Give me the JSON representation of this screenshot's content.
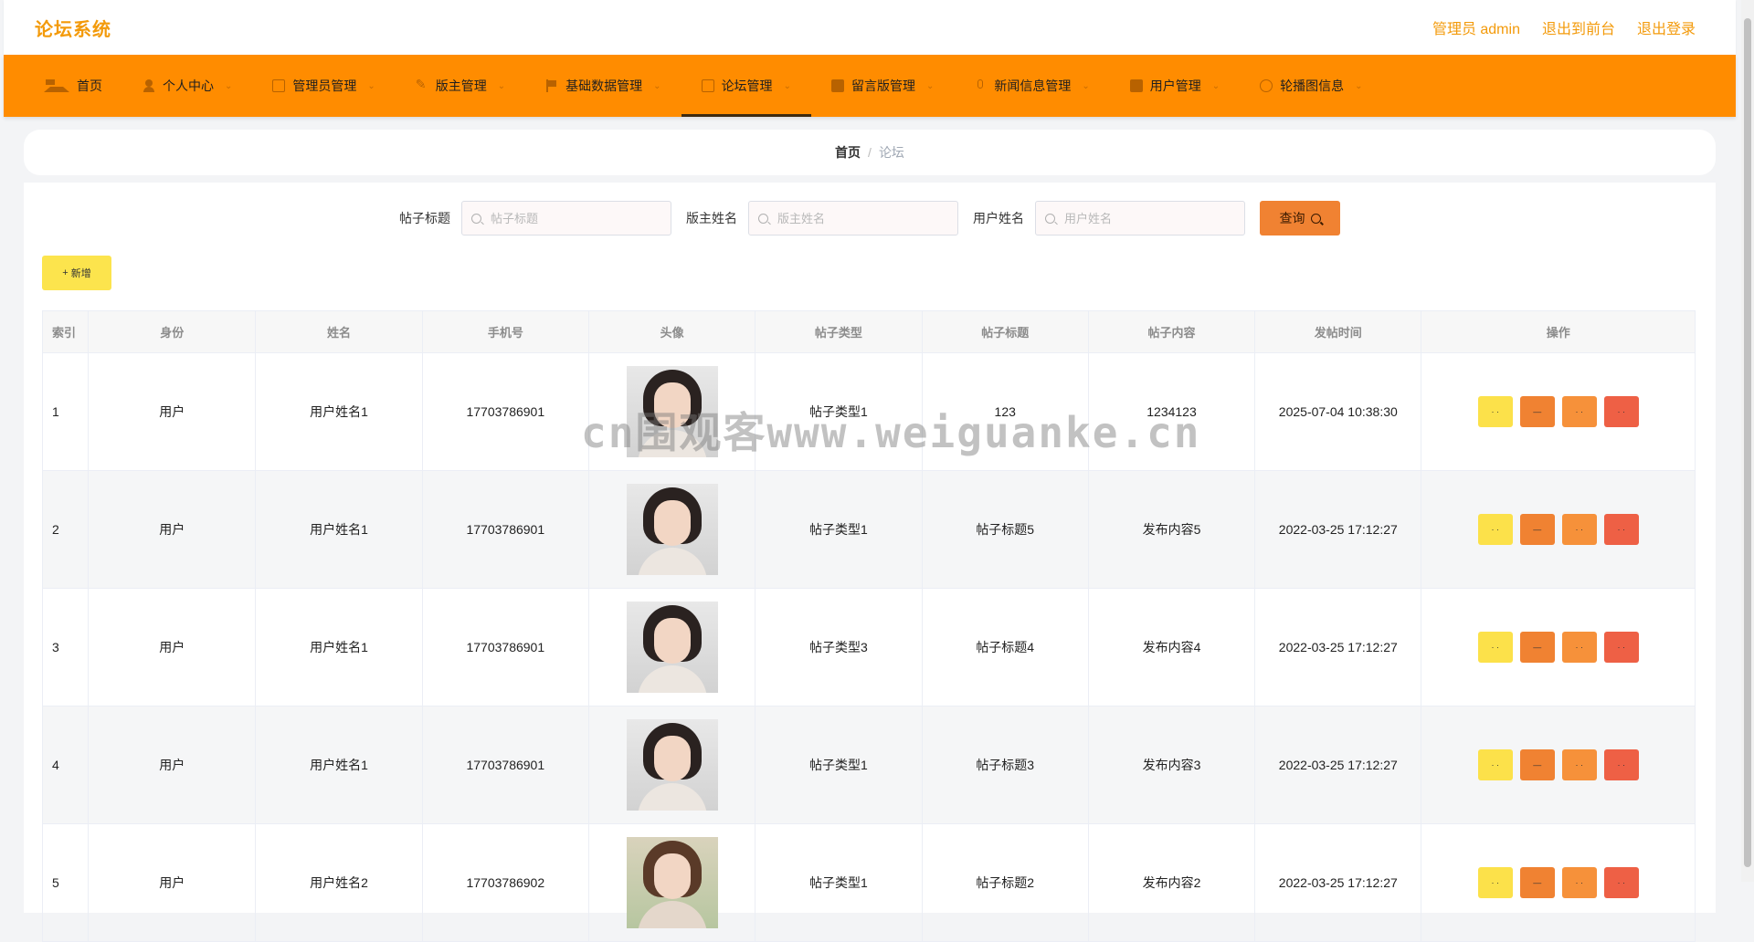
{
  "header": {
    "brand": "论坛系统",
    "links": [
      "管理员 admin",
      "退出到前台",
      "退出登录"
    ]
  },
  "nav": [
    {
      "label": "首页",
      "icon": "home-icon"
    },
    {
      "label": "个人中心",
      "icon": "user-icon"
    },
    {
      "label": "管理员管理",
      "icon": "admin-icon"
    },
    {
      "label": "版主管理",
      "icon": "edit-icon"
    },
    {
      "label": "基础数据管理",
      "icon": "flag-icon"
    },
    {
      "label": "论坛管理",
      "icon": "forum-icon",
      "active": true
    },
    {
      "label": "留言版管理",
      "icon": "message-icon"
    },
    {
      "label": "新闻信息管理",
      "icon": "mic-icon"
    },
    {
      "label": "用户管理",
      "icon": "users-icon"
    },
    {
      "label": "轮播图信息",
      "icon": "carousel-icon"
    }
  ],
  "breadcrumb": {
    "home": "首页",
    "sep": "/",
    "current": "论坛"
  },
  "search": {
    "fields": [
      {
        "label": "帖子标题",
        "placeholder": "帖子标题"
      },
      {
        "label": "版主姓名",
        "placeholder": "版主姓名"
      },
      {
        "label": "用户姓名",
        "placeholder": "用户姓名"
      }
    ],
    "query_label": "查询"
  },
  "add_button": {
    "icon": "+",
    "label": "新增"
  },
  "table": {
    "columns": [
      "索引",
      "身份",
      "姓名",
      "手机号",
      "头像",
      "帖子类型",
      "帖子标题",
      "帖子内容",
      "发帖时间",
      "操作"
    ],
    "rows": [
      {
        "idx": "1",
        "role": "用户",
        "name": "用户姓名1",
        "phone": "17703786901",
        "type": "帖子类型1",
        "title": "123",
        "content": "1234123",
        "time": "2025-07-04 10:38:30"
      },
      {
        "idx": "2",
        "role": "用户",
        "name": "用户姓名1",
        "phone": "17703786901",
        "type": "帖子类型1",
        "title": "帖子标题5",
        "content": "发布内容5",
        "time": "2022-03-25 17:12:27"
      },
      {
        "idx": "3",
        "role": "用户",
        "name": "用户姓名1",
        "phone": "17703786901",
        "type": "帖子类型3",
        "title": "帖子标题4",
        "content": "发布内容4",
        "time": "2022-03-25 17:12:27"
      },
      {
        "idx": "4",
        "role": "用户",
        "name": "用户姓名1",
        "phone": "17703786901",
        "type": "帖子类型1",
        "title": "帖子标题3",
        "content": "发布内容3",
        "time": "2022-03-25 17:12:27"
      },
      {
        "idx": "5",
        "role": "用户",
        "name": "用户姓名2",
        "phone": "17703786902",
        "type": "帖子类型1",
        "title": "帖子标题2",
        "content": "发布内容2",
        "time": "2022-03-25 17:12:27"
      }
    ],
    "op_labels": [
      "· ·",
      "—",
      "· ·",
      "· ·"
    ]
  },
  "watermark": "cn围观客www.weiguanke.cn",
  "colors": {
    "brand": "#f39a0a",
    "nav_bg": "#ff8c00",
    "query": "#f08232",
    "add": "#fce44d",
    "delete": "#ee6045"
  }
}
